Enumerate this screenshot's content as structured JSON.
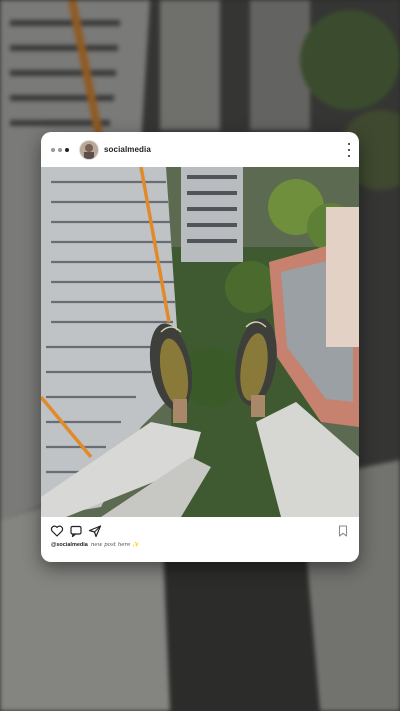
{
  "post": {
    "username": "socialmedia",
    "caption_handle": "@socialmedia",
    "caption_text": "new post here ✨"
  },
  "icons": {
    "carousel_dots": "carousel-dots-icon",
    "more": "more-vertical-icon",
    "like": "heart-icon",
    "comment": "comment-icon",
    "share": "send-icon",
    "save": "bookmark-icon"
  },
  "colors": {
    "card": "#ffffff",
    "text": "#222222"
  }
}
